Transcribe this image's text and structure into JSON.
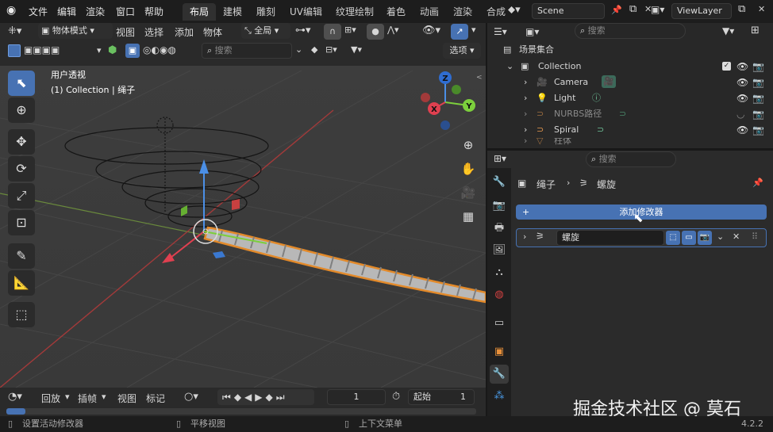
{
  "menu": {
    "file": "文件",
    "edit": "编辑",
    "render": "渲染",
    "window": "窗口",
    "help": "帮助"
  },
  "workspaces": [
    "布局",
    "建模",
    "雕刻",
    "UV编辑",
    "纹理绘制",
    "着色",
    "动画",
    "渲染",
    "合成"
  ],
  "scene": {
    "name": "Scene",
    "viewlayer": "ViewLayer"
  },
  "viewport": {
    "mode": "物体模式",
    "view": "视图",
    "select": "选择",
    "add": "添加",
    "object": "物体",
    "orientation": "全局",
    "search_placeholder": "搜索",
    "options": "选项",
    "view_name": "用户透视",
    "collection_info": "(1) Collection | 绳子"
  },
  "gizmo": {
    "z": "Z",
    "y": "Y",
    "x": "X"
  },
  "outliner": {
    "search_placeholder": "搜索",
    "root": "场景集合",
    "collection": "Collection",
    "items": [
      "Camera",
      "Light",
      "NURBS路径",
      "Spiral",
      "柱体"
    ]
  },
  "props": {
    "search_placeholder": "搜索",
    "object_name": "绳子",
    "modifier_context": "螺旋",
    "add_modifier": "添加修改器",
    "modifier_name": "螺旋"
  },
  "timeline": {
    "playback": "回放",
    "keying": "插帧",
    "view": "视图",
    "marker": "标记",
    "current_frame": "1",
    "start_label": "起始",
    "start_value": "1"
  },
  "status": {
    "left": "设置活动修改器",
    "middle": "平移视图",
    "right": "上下文菜单",
    "version": "4.2.2"
  },
  "watermark": "掘金技术社区 @ 莫石"
}
